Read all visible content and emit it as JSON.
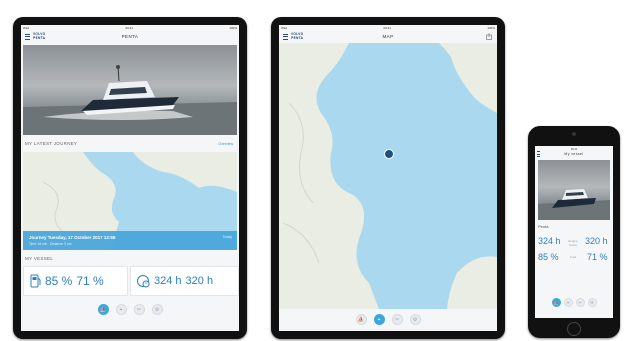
{
  "tablet1": {
    "status_left": "iPad",
    "status_center": "09:41",
    "status_right": "100%",
    "logo_line1": "VOLVO",
    "logo_line2": "PENTA",
    "title": "PENTA",
    "latest_journey_title": "MY LATEST JOURNEY",
    "overview_link": "Overview",
    "journey_line1": "Journey Tuesday, 17 October 2017 12:55",
    "journey_line2": "Time: 44 min  ·  Distance: 9 nm",
    "journey_right": "Today",
    "my_vessel_title": "MY VESSEL",
    "fuel_1": "85 %",
    "fuel_2": "71 %",
    "hours_1": "324 h",
    "hours_2": "320 h"
  },
  "tablet2": {
    "status_left": "iPad",
    "status_center": "09:41",
    "status_right": "100%",
    "logo_line1": "VOLVO",
    "logo_line2": "PENTA",
    "title": "MAP"
  },
  "phone": {
    "status_center": "09:41",
    "title": "My vessel",
    "vessel_label": "Penta",
    "hours_1": "324 h",
    "hours_2": "320 h",
    "fuel_1": "85 %",
    "fuel_2": "71 %",
    "hours_label": "Engine hours",
    "fuel_label": "Fuel"
  },
  "icons": {
    "tab_1": "vessel-icon",
    "tab_2": "map-icon",
    "tab_3": "service-icon",
    "tab_4": "settings-icon"
  }
}
